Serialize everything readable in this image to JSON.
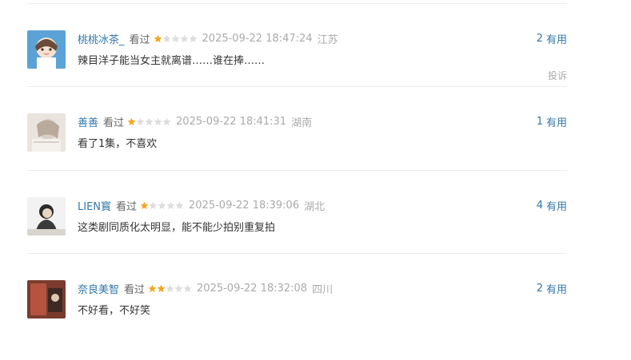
{
  "comments": [
    {
      "user": "桃桃冰茶_",
      "status": "看过",
      "rating": 1,
      "time": "2025-09-22 18:47:24",
      "location": "江苏",
      "content": "辣目洋子能当女主就离谱……谁在捧……",
      "votes": "2",
      "vote_label": "有用",
      "report_label": "投诉"
    },
    {
      "user": "善善",
      "status": "看过",
      "rating": 1,
      "time": "2025-09-22 18:41:31",
      "location": "湖南",
      "content": "看了1集，不喜欢",
      "votes": "1",
      "vote_label": "有用"
    },
    {
      "user": "LIEN寳",
      "status": "看过",
      "rating": 1,
      "time": "2025-09-22 18:39:06",
      "location": "湖北",
      "content": "这类剧同质化太明显，能不能少拍别重复拍",
      "votes": "4",
      "vote_label": "有用"
    },
    {
      "user": "奈良美智",
      "status": "看过",
      "rating": 2,
      "time": "2025-09-22 18:32:08",
      "location": "四川",
      "content": "不好看，不好笑",
      "votes": "2",
      "vote_label": "有用"
    }
  ],
  "colors": {
    "link": "#3377aa",
    "star_on": "#f5a623",
    "star_off": "#dddddd",
    "muted": "#aaaaaa"
  }
}
